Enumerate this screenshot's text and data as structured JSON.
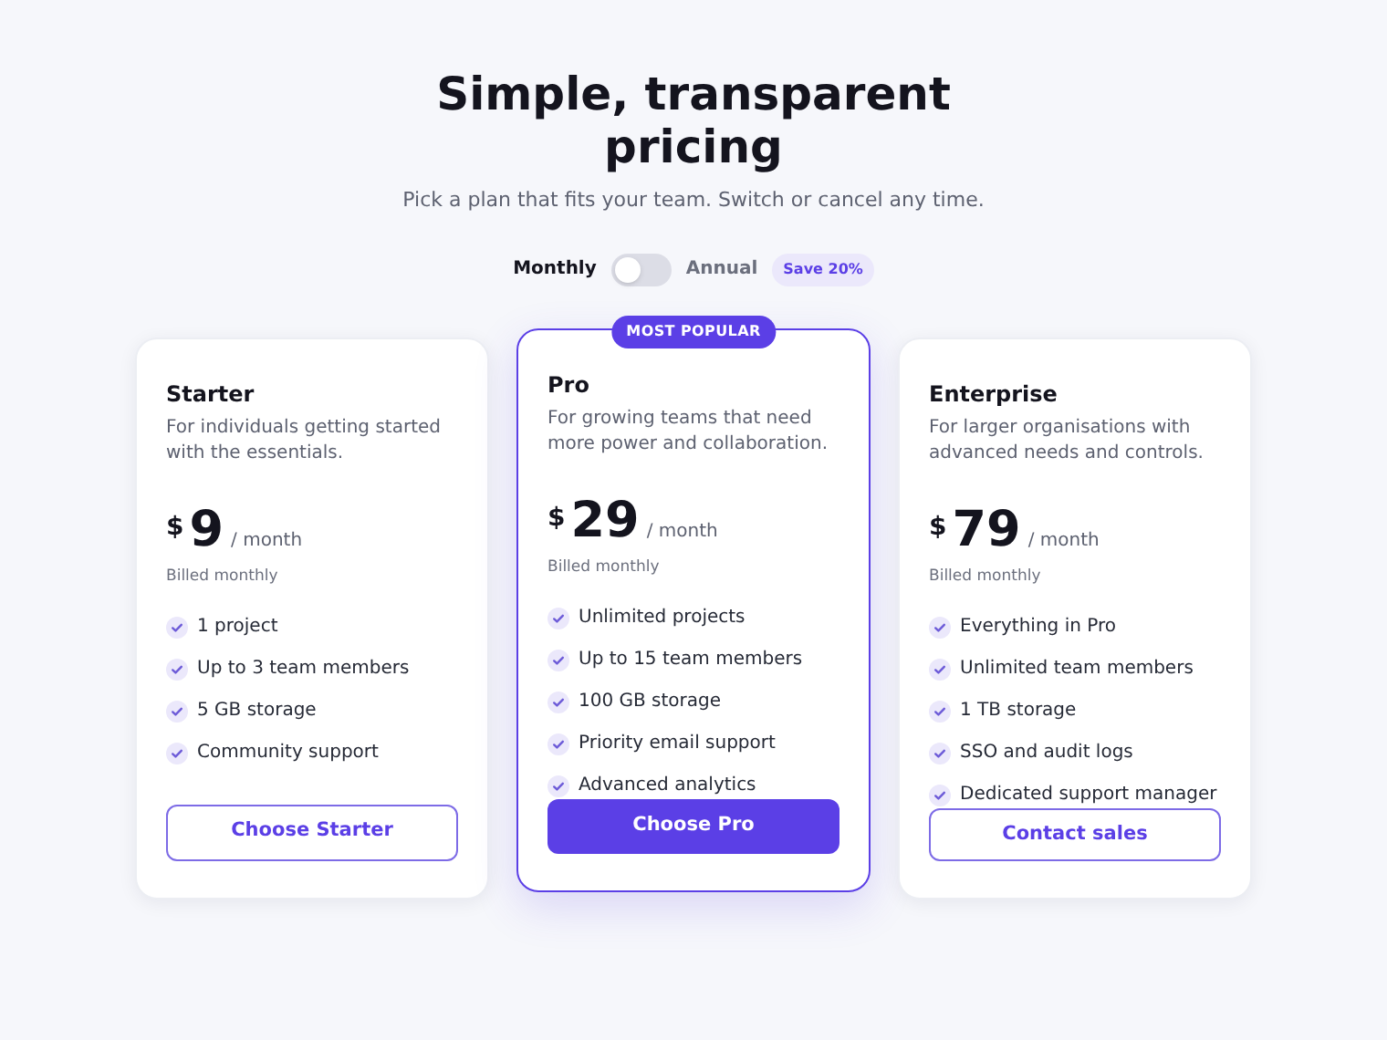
{
  "title": "Simple, transparent pricing",
  "subtitle": "Pick a plan that fits your team. Switch or cancel any time.",
  "billing": {
    "monthly_label": "Monthly",
    "annual_label": "Annual",
    "annual": false,
    "save_badge": "Save 20%"
  },
  "plans": [
    {
      "name": "Starter",
      "description": "For individuals getting started with the essentials.",
      "currency": "$",
      "price": "9",
      "period": "/ month",
      "billing_note": "Billed monthly",
      "featured": false,
      "features": [
        "1 project",
        "Up to 3 team members",
        "5 GB storage",
        "Community support"
      ],
      "button": "Choose Starter"
    },
    {
      "name": "Pro",
      "badge": "MOST POPULAR",
      "description": "For growing teams that need more power and collaboration.",
      "currency": "$",
      "price": "29",
      "period": "/ month",
      "billing_note": "Billed monthly",
      "featured": true,
      "features": [
        "Unlimited projects",
        "Up to 15 team members",
        "100 GB storage",
        "Priority email support",
        "Advanced analytics"
      ],
      "button": "Choose Pro"
    },
    {
      "name": "Enterprise",
      "description": "For larger organisations with advanced needs and controls.",
      "currency": "$",
      "price": "79",
      "period": "/ month",
      "billing_note": "Billed monthly",
      "featured": false,
      "features": [
        "Everything in Pro",
        "Unlimited team members",
        "1 TB storage",
        "SSO and audit logs",
        "Dedicated support manager"
      ],
      "button": "Contact sales"
    }
  ]
}
